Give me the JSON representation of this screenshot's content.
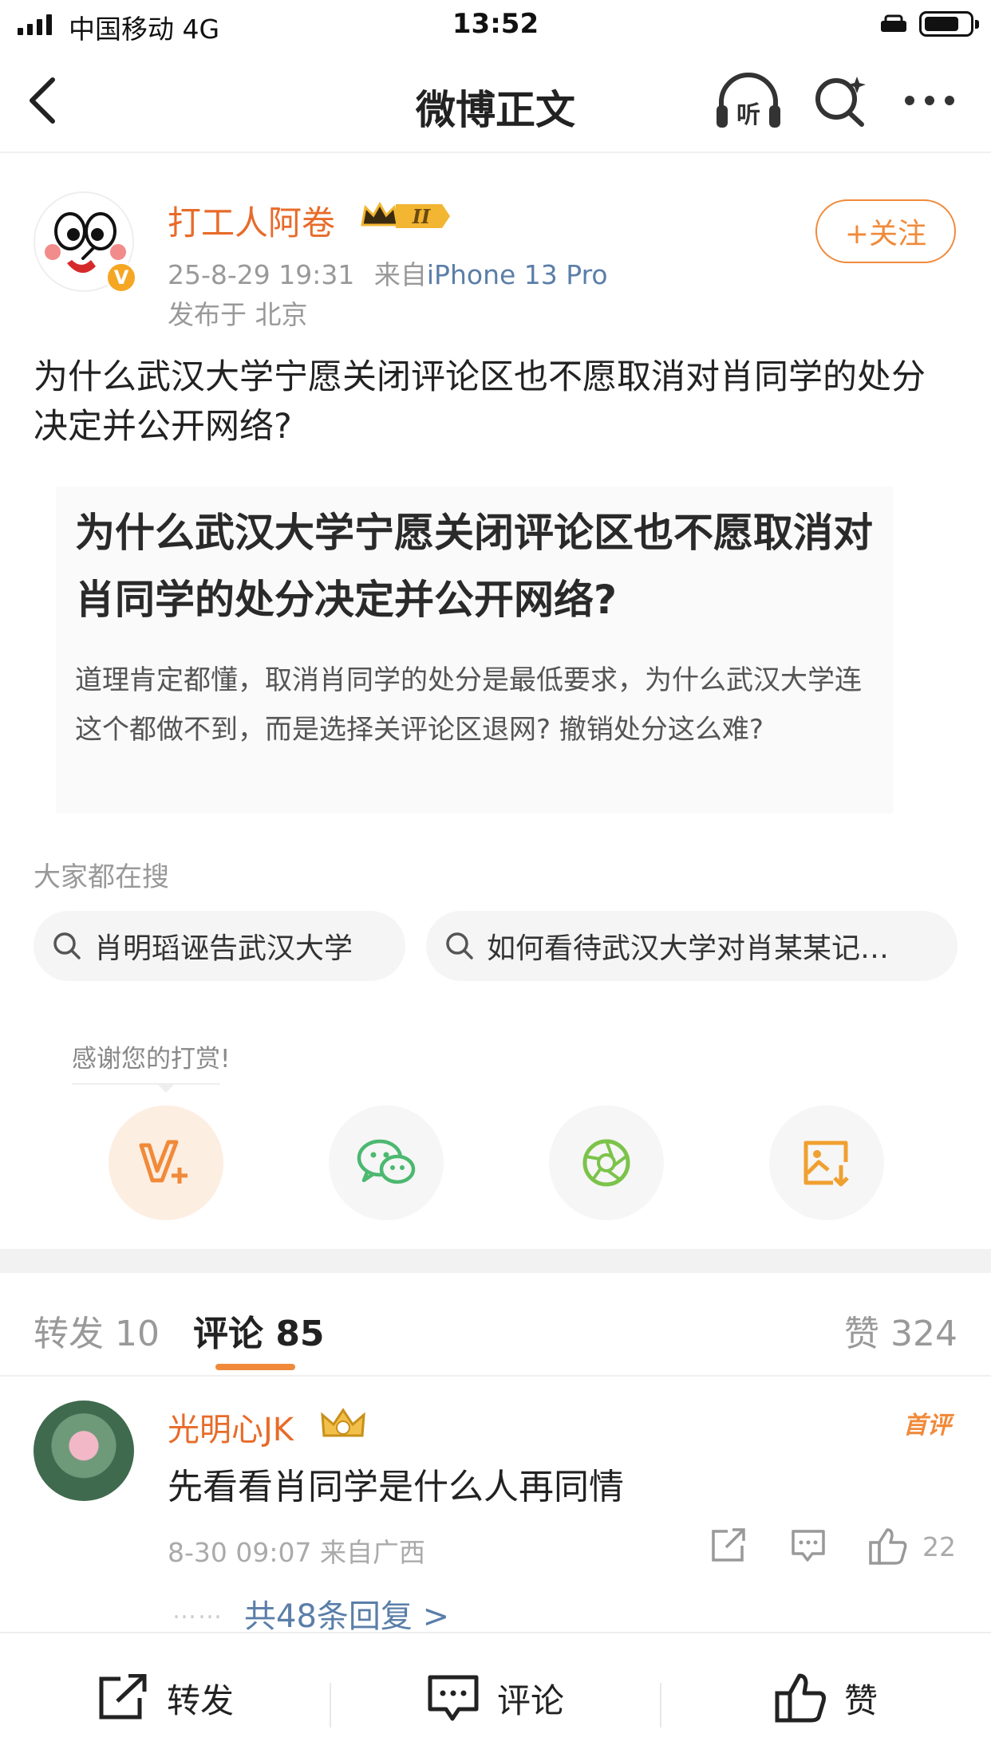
{
  "status_bar": {
    "carrier": "中国移动  4G",
    "time": "13:52"
  },
  "nav": {
    "title": "微博正文",
    "listen_label": "听",
    "icons": [
      "back-icon",
      "listen-icon",
      "search-icon",
      "more-icon"
    ]
  },
  "post": {
    "author": "打工人阿卷",
    "level_badge": "II",
    "timestamp": "25-8-29 19:31",
    "source_prefix": "来自",
    "device": "iPhone 13 Pro",
    "location": "发布于 北京",
    "follow_label": "+关注",
    "text": "为什么武汉大学宁愿关闭评论区也不愿取消对肖同学的处分决定并公开网络?",
    "image_title": "为什么武汉大学宁愿关闭评论区也不愿取消对肖同学的处分决定并公开网络?",
    "image_body": "道理肯定都懂，取消肖同学的处分是最低要求，为什么武汉大学连这个都做不到，而是选择关评论区退网? 撤销处分这么难?"
  },
  "search": {
    "label": "大家都在搜",
    "chips": [
      "肖明瑫诬告武汉大学",
      "如何看待武汉大学对肖某某记…"
    ]
  },
  "reward": {
    "thanks": "感谢您的打赏!",
    "share_icons": [
      "vplus-reward-icon",
      "wechat-icon",
      "moments-icon",
      "save-image-icon"
    ]
  },
  "tabs": {
    "repost": "转发 10",
    "comment": "评论 85",
    "like": "赞 324"
  },
  "comment": {
    "author": "光明心JK",
    "first_badge": "首评",
    "text": "先看看肖同学是什么人再同情",
    "meta": "8-30 09:07 来自广西",
    "likes": "22",
    "dots": "……",
    "replies": "共48条回复 >"
  },
  "bottom_bar": {
    "repost": "转发",
    "comment": "评论",
    "like": "赞"
  },
  "colors": {
    "accent_orange": "#f08a3a",
    "author_orange": "#e86b2a",
    "link_blue": "#5a7ea8"
  }
}
